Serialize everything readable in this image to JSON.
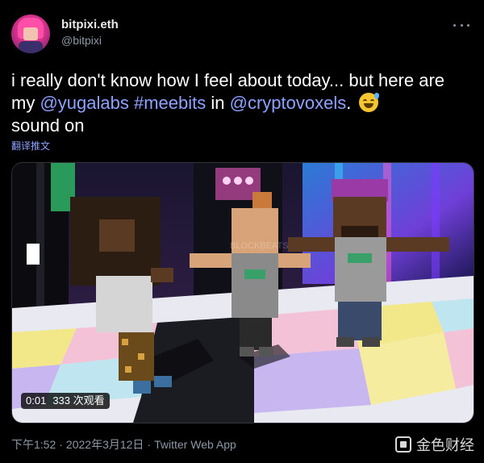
{
  "author": {
    "display_name": "bitpixi.eth",
    "handle": "@bitpixi"
  },
  "tweet": {
    "text_1": "i really don't know how I feel about today... but here are my ",
    "mention_yugalabs": "@yugalabs",
    "space_1": " ",
    "hashtag_meebits": "#meebits",
    "text_2": " in ",
    "mention_cryptovoxels": "@cryptovoxels",
    "text_3": ". ",
    "text_4": " sound on",
    "emoji": "sweat-smile-emoji",
    "translate_label": "翻译推文"
  },
  "video": {
    "elapsed": "0:01",
    "views": "333 次观看",
    "overlay_text": "BLOCKBEATS"
  },
  "footer": {
    "time": "下午1:52",
    "separator_1": "·",
    "date": "2022年3月12日",
    "separator_2": "·",
    "source": "Twitter Web App"
  },
  "watermark": {
    "label": "金色财经"
  },
  "colors": {
    "background": "#000000",
    "link": "#8ea2ff",
    "secondary_text": "#8b98a5",
    "primary_text": "#ffffff"
  }
}
